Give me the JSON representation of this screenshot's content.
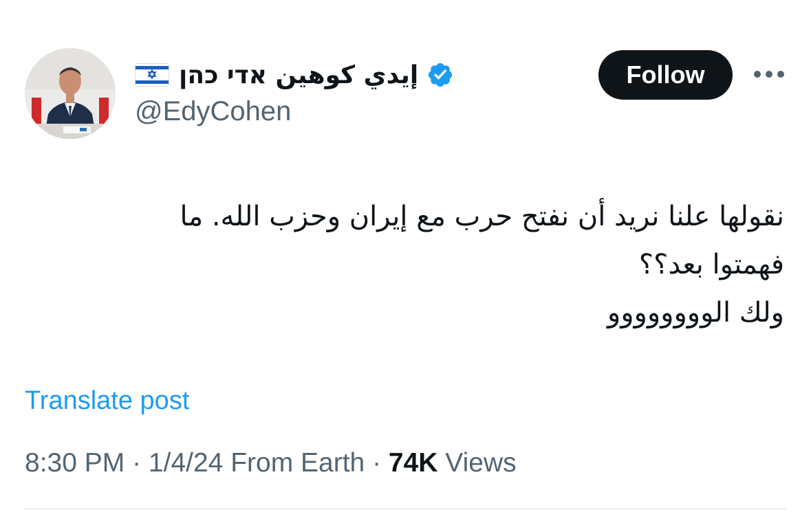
{
  "author": {
    "display_name": "إيدي كوهين אדי כהן",
    "handle": "@EdyCohen",
    "verified": true,
    "flag": "israel-flag",
    "avatar": "profile-photo"
  },
  "actions": {
    "follow_label": "Follow",
    "more_icon": "more-horizontal-icon"
  },
  "tweet": {
    "lines": [
      "نقولها علنا نريد أن نفتح حرب مع إيران وحزب الله.  ما",
      "فهمتوا بعد؟؟",
      "ولك الوووووووو"
    ],
    "translate_label": "Translate post"
  },
  "meta": {
    "time": "8:30 PM",
    "sep1": " · ",
    "date": "1/4/24",
    "location": " From Earth",
    "sep2": " · ",
    "views_count": "74K",
    "views_label": " Views"
  },
  "colors": {
    "text": "#0f1419",
    "secondary": "#536471",
    "link": "#1d9bf0",
    "verified": "#1d9bf0",
    "button_bg": "#0f1419"
  }
}
